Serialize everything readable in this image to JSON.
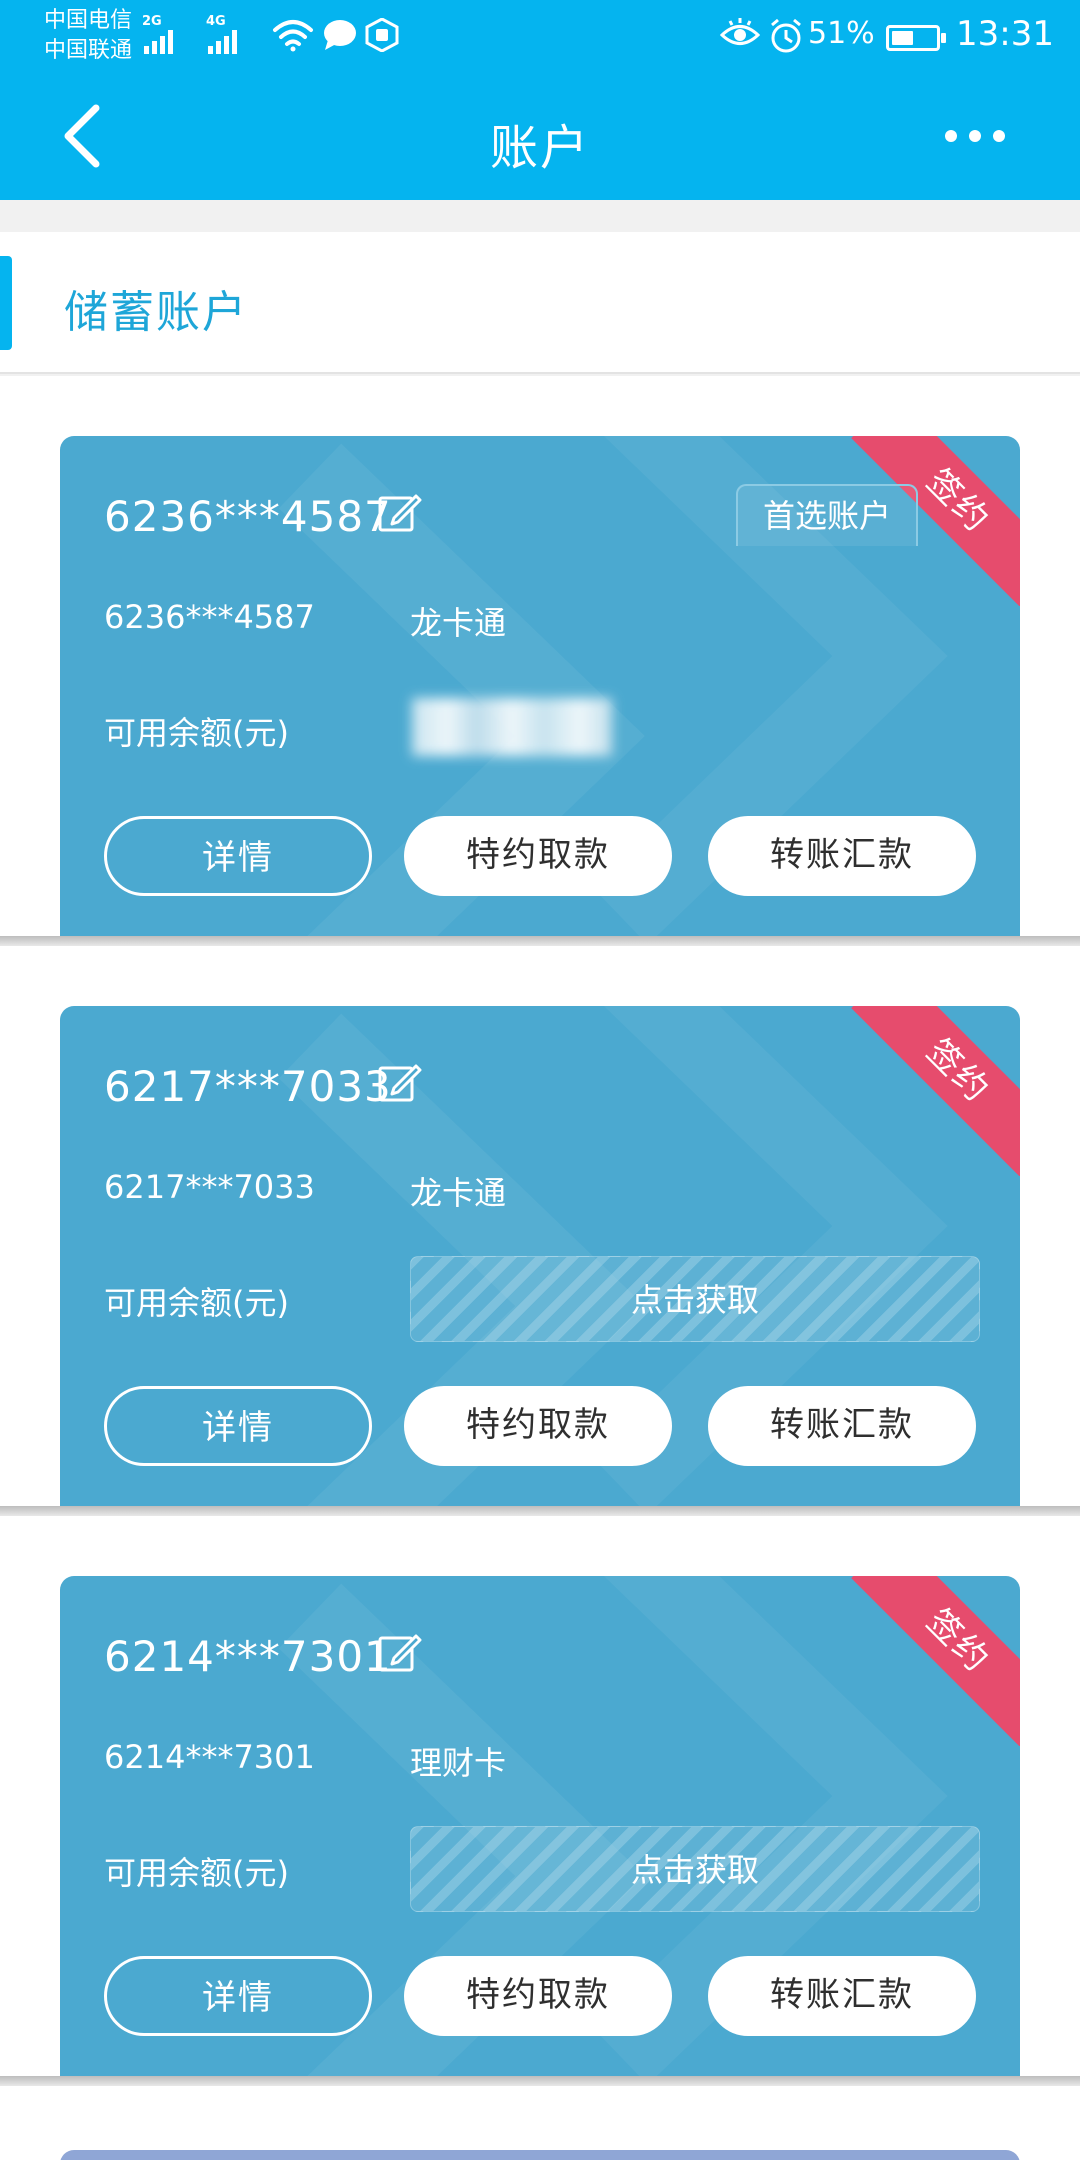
{
  "status_bar": {
    "carrier_1": "中国电信",
    "carrier_2": "中国联通",
    "network_1": "2G",
    "network_2": "4G",
    "battery_percent": "51%",
    "battery_level": 0.51,
    "time": "13:31",
    "icons": [
      "signal-icon",
      "wifi-icon",
      "chat-bubble-icon",
      "app-badge-icon",
      "eye-icon",
      "alarm-icon",
      "battery-icon"
    ]
  },
  "header": {
    "title": "账户",
    "back_icon": "chevron-left-icon",
    "more_icon": "more-dots-icon"
  },
  "section": {
    "title": "储蓄账户"
  },
  "colors": {
    "primary": "#05b4ef",
    "card": "#4ba9d0",
    "ribbon": "#e64c6d",
    "section_title": "#1ea6d8"
  },
  "accounts": [
    {
      "number": "6236***4587",
      "short_number": "6236***4587",
      "type": "龙卡通",
      "ribbon": "签约",
      "preferred_badge": "首选账户",
      "balance_label": "可用余额(元)",
      "buttons": {
        "details": "详情",
        "special_withdraw": "特约取款",
        "transfer": "转账汇款"
      }
    },
    {
      "number": "6217***7033",
      "short_number": "6217***7033",
      "type": "龙卡通",
      "ribbon": "签约",
      "balance_label": "可用余额(元)",
      "fetch_balance": "点击获取",
      "buttons": {
        "details": "详情",
        "special_withdraw": "特约取款",
        "transfer": "转账汇款"
      }
    },
    {
      "number": "6214***7301",
      "short_number": "6214***7301",
      "type": "理财卡",
      "ribbon": "签约",
      "balance_label": "可用余额(元)",
      "fetch_balance": "点击获取",
      "buttons": {
        "details": "详情",
        "special_withdraw": "特约取款",
        "transfer": "转账汇款"
      }
    }
  ]
}
